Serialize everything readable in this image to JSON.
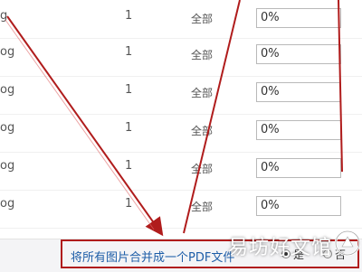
{
  "rows": [
    {
      "ext": "g",
      "count": "1",
      "range": "全部",
      "progress": "0%"
    },
    {
      "ext": "og",
      "count": "1",
      "range": "全部",
      "progress": "0%"
    },
    {
      "ext": "og",
      "count": "1",
      "range": "全部",
      "progress": "0%"
    },
    {
      "ext": "og",
      "count": "1",
      "range": "全部",
      "progress": "0%"
    },
    {
      "ext": "og",
      "count": "1",
      "range": "全部",
      "progress": "0%"
    },
    {
      "ext": "og",
      "count": "1",
      "range": "全部",
      "progress": "0%"
    }
  ],
  "merge": {
    "label": "将所有图片合并成一个PDF文件",
    "yes_label": "是",
    "no_label": "否",
    "selected": "yes"
  },
  "watermark": {
    "text": "易坊好文馆"
  },
  "colors": {
    "annotation": "#b01c1c",
    "link": "#1e5ea8"
  }
}
